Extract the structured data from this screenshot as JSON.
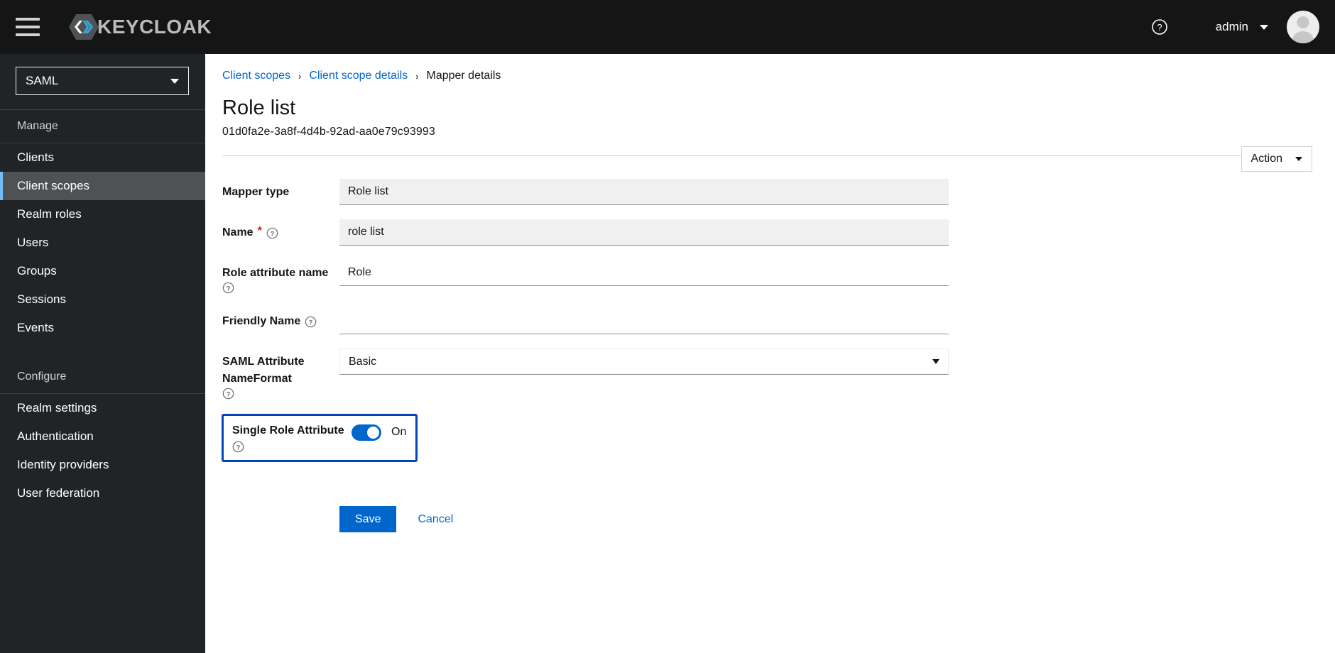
{
  "masthead": {
    "menu_icon": "hamburger-icon",
    "brand_text": "KEYCLOAK",
    "help_icon": "help-circle-icon",
    "user_name": "admin",
    "avatar_icon": "user-avatar-icon"
  },
  "sidebar": {
    "realm": {
      "selected": "SAML"
    },
    "groups": [
      {
        "title": "Manage",
        "items": [
          {
            "label": "Clients",
            "active": false
          },
          {
            "label": "Client scopes",
            "active": true
          },
          {
            "label": "Realm roles",
            "active": false
          },
          {
            "label": "Users",
            "active": false
          },
          {
            "label": "Groups",
            "active": false
          },
          {
            "label": "Sessions",
            "active": false
          },
          {
            "label": "Events",
            "active": false
          }
        ]
      },
      {
        "title": "Configure",
        "items": [
          {
            "label": "Realm settings",
            "active": false
          },
          {
            "label": "Authentication",
            "active": false
          },
          {
            "label": "Identity providers",
            "active": false
          },
          {
            "label": "User federation",
            "active": false
          }
        ]
      }
    ]
  },
  "page": {
    "breadcrumb": {
      "item1": "Client scopes",
      "item2": "Client scope details",
      "current": "Mapper details",
      "separator": "›"
    },
    "title": "Role list",
    "subtitle": "01d0fa2e-3a8f-4d4b-92ad-aa0e79c93993",
    "action_label": "Action"
  },
  "form": {
    "mapper_type": {
      "label": "Mapper type",
      "value": "Role list"
    },
    "name": {
      "label": "Name",
      "required_marker": "*",
      "value": "role list"
    },
    "role_attribute_name": {
      "label": "Role attribute name",
      "value": "Role"
    },
    "friendly_name": {
      "label": "Friendly Name",
      "value": "",
      "placeholder": ""
    },
    "saml_attribute_nameformat": {
      "label": "SAML Attribute NameFormat",
      "value": "Basic"
    },
    "single_role_attribute": {
      "label": "Single Role Attribute",
      "state": "On",
      "checked": true
    },
    "save_label": "Save",
    "cancel_label": "Cancel"
  },
  "colors": {
    "accent_blue": "#0066cc",
    "link_blue": "#0066cc",
    "masthead_bg": "#151515",
    "sidebar_bg": "#212427",
    "active_nav_bg": "#4f5255",
    "active_nav_border": "#73bcf7",
    "highlight_border": "#0047b3",
    "required_red": "#c9190b"
  }
}
